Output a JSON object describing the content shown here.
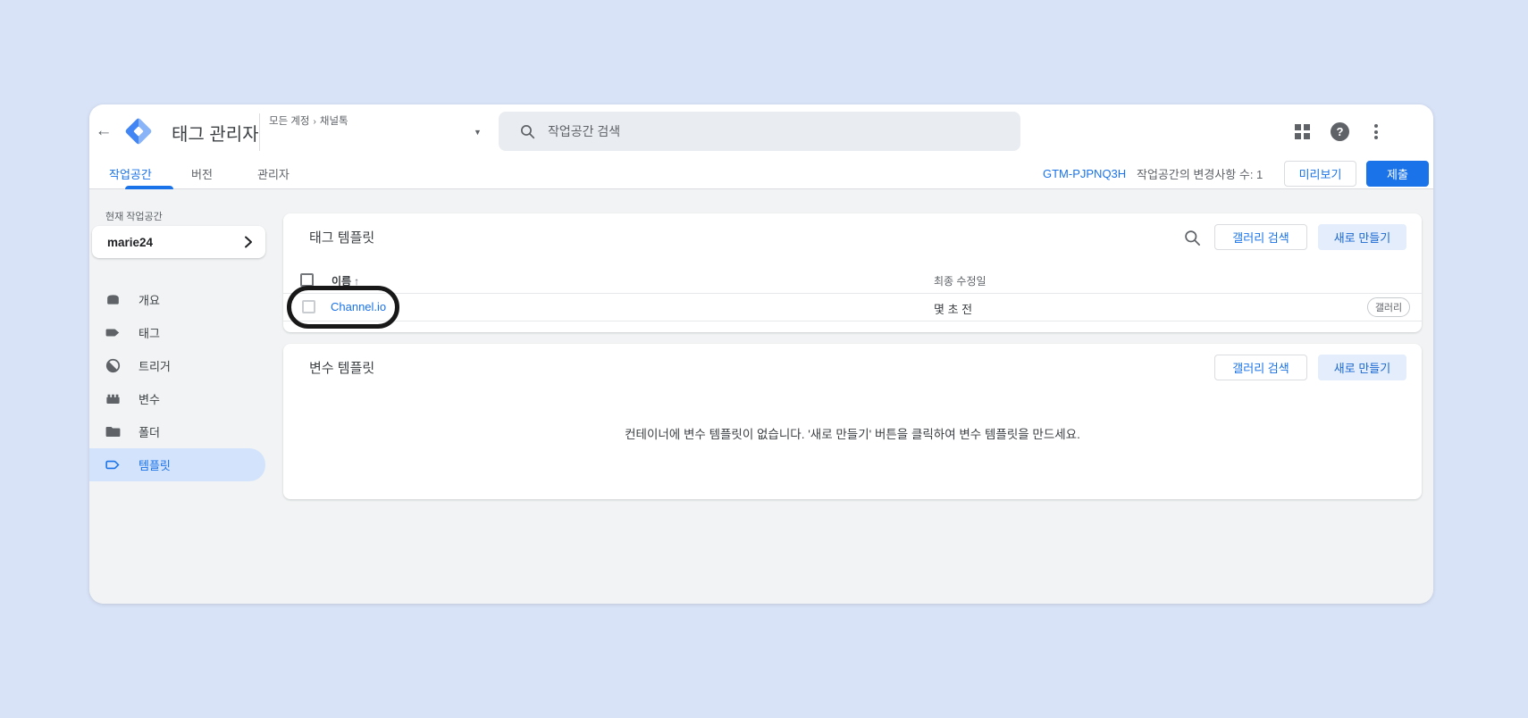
{
  "header": {
    "back_icon": "arrow-left",
    "app_title": "태그 관리자",
    "breadcrumb": {
      "account": "모든 계정",
      "separator": "›",
      "container": "채널톡"
    },
    "search_placeholder": "작업공간 검색",
    "icons": [
      "apps-grid-icon",
      "help-icon",
      "kebab-menu-icon"
    ],
    "help_glyph": "?"
  },
  "tabbar": {
    "tabs": [
      {
        "label": "작업공간",
        "active": true
      },
      {
        "label": "버전",
        "active": false
      },
      {
        "label": "관리자",
        "active": false
      }
    ],
    "container_id": "GTM-PJPNQ3H",
    "changes_label": "작업공간의 변경사항 수: 1",
    "preview_button": "미리보기",
    "submit_button": "제출"
  },
  "sidebar": {
    "current_workspace_label": "현재 작업공간",
    "workspace_name": "marie24",
    "items": [
      {
        "label": "개요",
        "icon": "overview-icon",
        "selected": false
      },
      {
        "label": "태그",
        "icon": "tag-icon",
        "selected": false
      },
      {
        "label": "트리거",
        "icon": "trigger-icon",
        "selected": false
      },
      {
        "label": "변수",
        "icon": "variable-icon",
        "selected": false
      },
      {
        "label": "폴더",
        "icon": "folder-icon",
        "selected": false
      },
      {
        "label": "템플릿",
        "icon": "template-icon",
        "selected": true
      }
    ]
  },
  "tag_templates": {
    "title": "태그 템플릿",
    "gallery_search_button": "갤러리 검색",
    "new_button": "새로 만들기",
    "columns": {
      "name": "이름",
      "sort_indicator": "↑",
      "last_modified": "최종 수정일"
    },
    "rows": [
      {
        "name": "Channel.io",
        "last_modified": "몇 초 전",
        "badge": "갤러리"
      }
    ]
  },
  "variable_templates": {
    "title": "변수 템플릿",
    "gallery_search_button": "갤러리 검색",
    "new_button": "새로 만들기",
    "empty_message": "컨테이너에 변수 템플릿이 없습니다. '새로 만들기' 버튼을 클릭하여 변수 템플릿을 만드세요."
  },
  "annotation": {
    "type": "ellipse-highlight",
    "target": "Channel.io 행",
    "color": "#181818"
  },
  "colors": {
    "accent": "#1a73e8",
    "page_bg": "#d9e3f8",
    "body_bg": "#f1f3f4",
    "selected_pill": "#d4e3fc"
  }
}
